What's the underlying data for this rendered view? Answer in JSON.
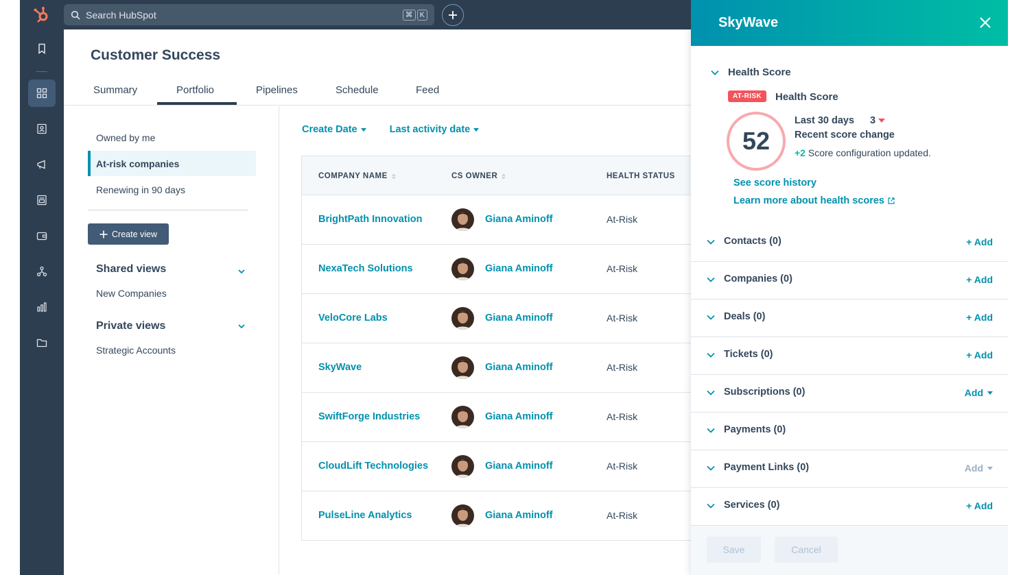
{
  "search": {
    "placeholder": "Search HubSpot",
    "shortcut_keys": [
      "⌘",
      "K"
    ]
  },
  "topbar": {
    "add_icon": "plus-icon"
  },
  "sidebar": {
    "items": [
      {
        "icon": "bookmark-icon"
      },
      {
        "icon": "grid-icon",
        "active": true
      },
      {
        "icon": "contacts-icon"
      },
      {
        "icon": "megaphone-icon"
      },
      {
        "icon": "content-icon"
      },
      {
        "icon": "wallet-icon"
      },
      {
        "icon": "workflow-icon"
      },
      {
        "icon": "reports-icon"
      },
      {
        "icon": "folder-icon"
      }
    ]
  },
  "page": {
    "title": "Customer Success",
    "tabs": [
      {
        "label": "Summary"
      },
      {
        "label": "Portfolio",
        "active": true
      },
      {
        "label": "Pipelines"
      },
      {
        "label": "Schedule"
      },
      {
        "label": "Feed"
      }
    ]
  },
  "views": {
    "items": [
      {
        "label": "Owned by me"
      },
      {
        "label": "At-risk companies",
        "active": true
      },
      {
        "label": "Renewing in 90 days"
      }
    ],
    "create_label": "Create view",
    "shared": {
      "heading": "Shared views",
      "items": [
        "New Companies"
      ]
    },
    "private": {
      "heading": "Private views",
      "items": [
        "Strategic Accounts"
      ]
    }
  },
  "filters": {
    "create_date": "Create Date",
    "last_activity": "Last activity date"
  },
  "table": {
    "headers": {
      "company": "COMPANY NAME",
      "owner": "CS OWNER",
      "status": "HEALTH STATUS"
    },
    "rows": [
      {
        "company": "BrightPath Innovation",
        "owner": "Giana Aminoff",
        "status": "At-Risk"
      },
      {
        "company": "NexaTech Solutions",
        "owner": "Giana Aminoff",
        "status": "At-Risk"
      },
      {
        "company": "VeloCore Labs",
        "owner": "Giana Aminoff",
        "status": "At-Risk"
      },
      {
        "company": "SkyWave",
        "owner": "Giana Aminoff",
        "status": "At-Risk"
      },
      {
        "company": "SwiftForge Industries",
        "owner": "Giana Aminoff",
        "status": "At-Risk"
      },
      {
        "company": "CloudLift Technologies",
        "owner": "Giana Aminoff",
        "status": "At-Risk"
      },
      {
        "company": "PulseLine Analytics",
        "owner": "Giana Aminoff",
        "status": "At-Risk"
      }
    ]
  },
  "drawer": {
    "title": "SkyWave",
    "health": {
      "section_label": "Health Score",
      "badge": "AT-RISK",
      "label": "Health Score",
      "score": "52",
      "period": "Last 30 days",
      "change_value": "3",
      "change_direction": "down",
      "recent_label": "Recent score change",
      "change_amount": "+2",
      "change_text": "Score configuration updated.",
      "history_link": "See score history",
      "learn_link": "Learn more about health scores"
    },
    "sections": [
      {
        "name": "Contacts (0)",
        "add": "+ Add"
      },
      {
        "name": "Companies (0)",
        "add": "+ Add"
      },
      {
        "name": "Deals (0)",
        "add": "+ Add"
      },
      {
        "name": "Tickets (0)",
        "add": "+ Add"
      },
      {
        "name": "Subscriptions (0)",
        "add": "Add",
        "dropdown": true
      },
      {
        "name": "Payments (0)",
        "add": ""
      },
      {
        "name": "Payment Links (0)",
        "add": "Add",
        "dropdown": true,
        "disabled": true
      },
      {
        "name": "Services (0)",
        "add": "+ Add"
      }
    ],
    "save_label": "Save",
    "cancel_label": "Cancel"
  },
  "colors": {
    "nav": "#2d3e50",
    "accent": "#0091ae",
    "teal": "#00bda5",
    "danger": "#f2545b",
    "brand_orange": "#ff7a59"
  }
}
